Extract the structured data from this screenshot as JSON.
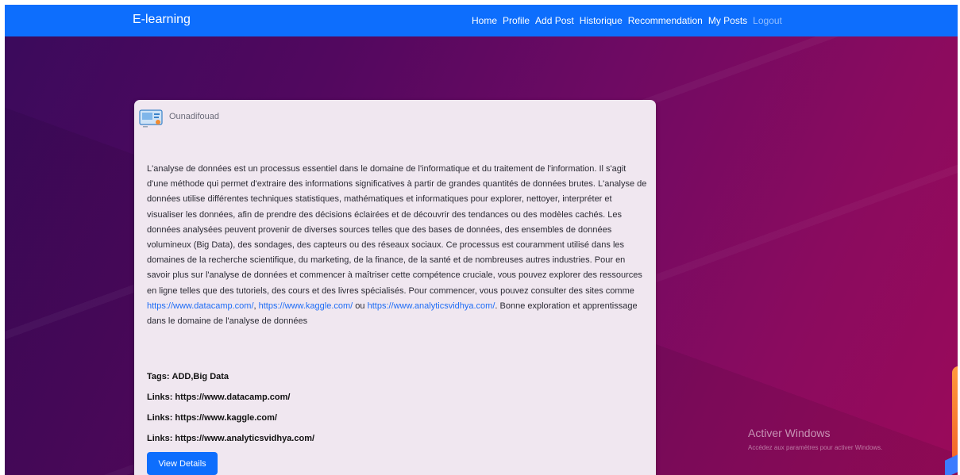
{
  "navbar": {
    "brand": "E-learning",
    "links": [
      "Home",
      "Profile",
      "Add Post",
      "Historique",
      "Recommendation",
      "My Posts",
      "Logout"
    ]
  },
  "post": {
    "author": "Ounadifouad",
    "avatar_icon": "course-thumbnail-icon",
    "body_text": "L'analyse de données est un processus essentiel dans le domaine de l'informatique et du traitement de l'information. Il s'agit d'une méthode qui permet d'extraire des informations significatives à partir de grandes quantités de données brutes. L'analyse de données utilise différentes techniques statistiques, mathématiques et informatiques pour explorer, nettoyer, interpréter et visualiser les données, afin de prendre des décisions éclairées et de découvrir des tendances ou des modèles cachés. Les données analysées peuvent provenir de diverses sources telles que des bases de données, des ensembles de données volumineux (Big Data), des sondages, des capteurs ou des réseaux sociaux. Ce processus est couramment utilisé dans les domaines de la recherche scientifique, du marketing, de la finance, de la santé et de nombreuses autres industries. Pour en savoir plus sur l'analyse de données et commencer à maîtriser cette compétence cruciale, vous pouvez explorer des ressources en ligne telles que des tutoriels, des cours et des livres spécialisés. Pour commencer, vous pouvez consulter des sites comme",
    "link1": "https://www.datacamp.com/",
    "sep1": ", ",
    "link2": "https://www.kaggle.com/",
    "sep2": " ou",
    "link3": "https://www.analyticsvidhya.com/",
    "body_end": ". Bonne exploration et apprentissage dans le domaine de l'analyse de données",
    "tags_label": "Tags:",
    "tags_value": "ADD,Big Data",
    "links_label": "Links:",
    "links": [
      "https://www.datacamp.com/",
      "https://www.kaggle.com/",
      "https://www.analyticsvidhya.com/"
    ],
    "view_details_label": "View Details"
  },
  "watermark": {
    "title": "Activer Windows",
    "subtitle": "Accédez aux paramètres pour activer Windows."
  },
  "colors": {
    "navbar": "#0d6efd",
    "card": "#f0e7f0",
    "link": "#1d6cf5"
  }
}
